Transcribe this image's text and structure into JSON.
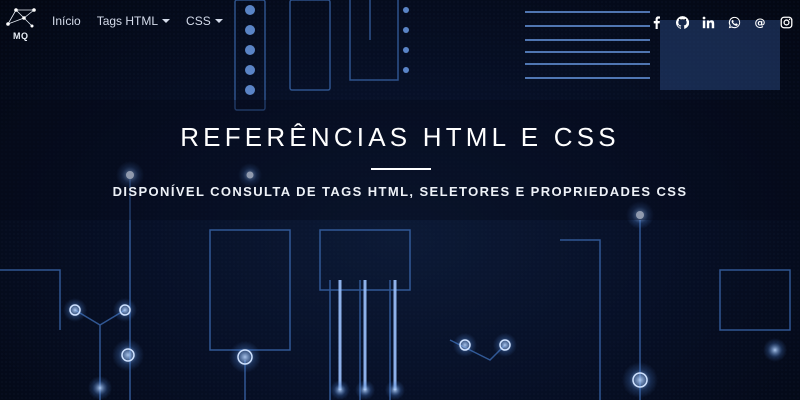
{
  "brand": {
    "logo_text": "MQ"
  },
  "nav": {
    "items": [
      {
        "label": "Início",
        "dropdown": false
      },
      {
        "label": "Tags HTML",
        "dropdown": true
      },
      {
        "label": "CSS",
        "dropdown": true
      }
    ]
  },
  "social": {
    "icons": [
      "facebook-icon",
      "github-icon",
      "linkedin-icon",
      "whatsapp-icon",
      "email-icon",
      "instagram-icon"
    ]
  },
  "hero": {
    "title": "REFERÊNCIAS HTML E CSS",
    "subtitle": "DISPONÍVEL CONSULTA DE TAGS HTML, SELETORES E PROPRIEDADES CSS"
  },
  "colors": {
    "background": "#050a18",
    "circuit_glow": "#7fb2ff",
    "text": "#ffffff"
  }
}
